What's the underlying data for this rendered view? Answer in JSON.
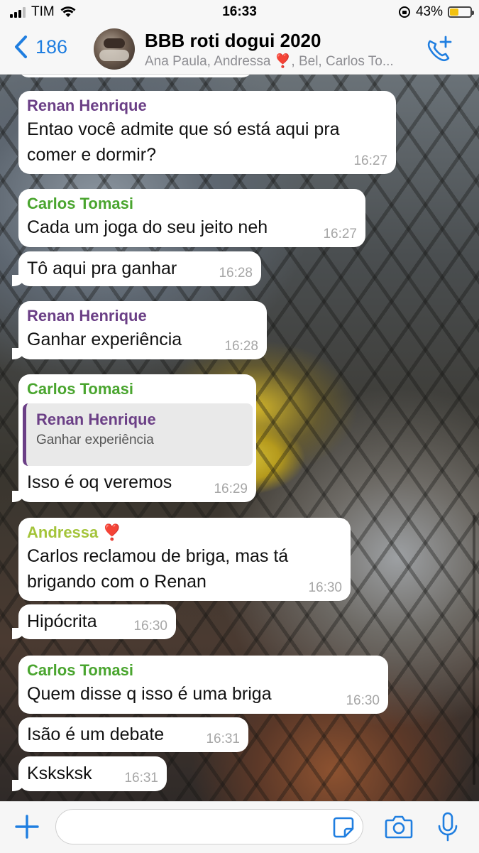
{
  "status_bar": {
    "carrier": "TIM",
    "time": "16:33",
    "battery_percent": "43%",
    "battery_level": 0.43
  },
  "header": {
    "back_count": "186",
    "group_name": "BBB roti dogui 2020",
    "members": "Ana Paula, Andressa ❣️, Bel, Carlos To..."
  },
  "messages": [
    {
      "sender": "Renan Henrique",
      "lines": [
        "Entao você admite que só está aqui pra",
        "comer e dormir?"
      ],
      "time": "16:27"
    },
    {
      "sender": "Carlos Tomasi",
      "lines": [
        "Cada um joga do seu jeito neh"
      ],
      "time": "16:27"
    },
    {
      "lines": [
        "Tô aqui pra ganhar"
      ],
      "time": "16:28"
    },
    {
      "sender": "Renan Henrique",
      "lines": [
        "Ganhar experiência"
      ],
      "time": "16:28"
    },
    {
      "sender": "Carlos Tomasi",
      "quote": {
        "sender": "Renan Henrique",
        "text": "Ganhar experiência"
      },
      "lines": [
        "Isso é oq veremos"
      ],
      "time": "16:29"
    },
    {
      "sender": "Andressa",
      "sender_emoji": "❣️",
      "lines": [
        "Carlos reclamou de briga, mas tá",
        "brigando com o Renan"
      ],
      "time": "16:30"
    },
    {
      "lines": [
        "Hipócrita"
      ],
      "time": "16:30"
    },
    {
      "sender": "Carlos Tomasi",
      "lines": [
        "Quem disse q isso é uma briga"
      ],
      "time": "16:30"
    },
    {
      "lines": [
        "Isão é um debate"
      ],
      "time": "16:31"
    },
    {
      "lines": [
        "Ksksksk"
      ],
      "time": "16:31"
    }
  ],
  "input": {
    "placeholder": ""
  },
  "colors": {
    "accent": "#1f7ee0",
    "renan": "#6b3f86",
    "carlos": "#4aa52f",
    "andressa": "#a4c43b"
  },
  "icons": [
    "signal-icon",
    "wifi-icon",
    "orientation-lock-icon",
    "battery-icon",
    "chevron-left-icon",
    "add-call-icon",
    "plus-icon",
    "sticker-icon",
    "camera-icon",
    "mic-icon"
  ]
}
